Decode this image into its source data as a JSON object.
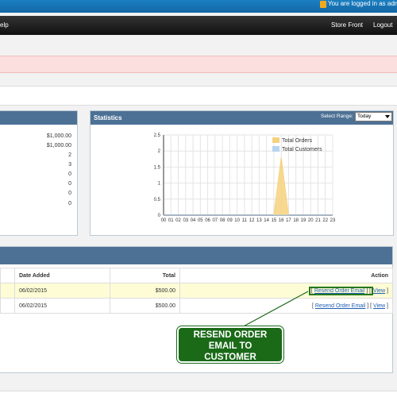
{
  "topbar": {
    "logged_in_text": "You are logged in as admin"
  },
  "nav": {
    "help_label": "elp",
    "store_front_label": "Store Front",
    "logout_label": "Logout"
  },
  "summary": {
    "values": [
      "$1,000.00",
      "$1,000.00",
      "2",
      "3",
      "0",
      "0",
      "0",
      "0"
    ]
  },
  "statistics": {
    "title": "Statistics",
    "range_label": "Select Range:",
    "range_value": "Today"
  },
  "chart_data": {
    "type": "area",
    "x": [
      "00",
      "01",
      "02",
      "03",
      "04",
      "05",
      "06",
      "07",
      "08",
      "09",
      "10",
      "11",
      "12",
      "13",
      "14",
      "15",
      "16",
      "17",
      "18",
      "19",
      "20",
      "21",
      "22",
      "23"
    ],
    "series": [
      {
        "name": "Total Orders",
        "values": [
          0,
          0,
          0,
          0,
          0,
          0,
          0,
          0,
          0,
          0,
          0,
          0,
          0,
          0,
          0,
          0,
          1.8,
          0,
          0,
          0,
          0,
          0,
          0,
          0
        ],
        "color": "#f6d27e"
      },
      {
        "name": "Total Customers",
        "values": [
          0,
          0,
          0,
          0,
          0,
          0,
          0,
          0,
          0,
          0,
          0,
          0,
          0,
          0,
          0,
          0,
          0,
          0,
          0,
          0,
          0,
          0,
          0,
          0
        ],
        "color": "#b7d4f0"
      }
    ],
    "y_ticks": [
      "0",
      "0.5",
      "1",
      "1.5",
      "2",
      "2.5"
    ],
    "ylim": [
      0,
      2.5
    ],
    "grid": true,
    "legend": "top-right"
  },
  "orders": {
    "headers": {
      "date_added": "Date Added",
      "total": "Total",
      "action": "Action"
    },
    "rows": [
      {
        "date": "06/02/2015",
        "total": "$500.00"
      },
      {
        "date": "06/02/2015",
        "total": "$500.00"
      }
    ],
    "resend_label": "Resend Order Email",
    "view_label": "View",
    "bracket_open": "[",
    "bracket_mid": "] [",
    "bracket_close": "]"
  },
  "callout": {
    "line1": "RESEND ORDER",
    "line2": "EMAIL TO",
    "line3": "CUSTOMER",
    "color": "#1a6a18"
  }
}
